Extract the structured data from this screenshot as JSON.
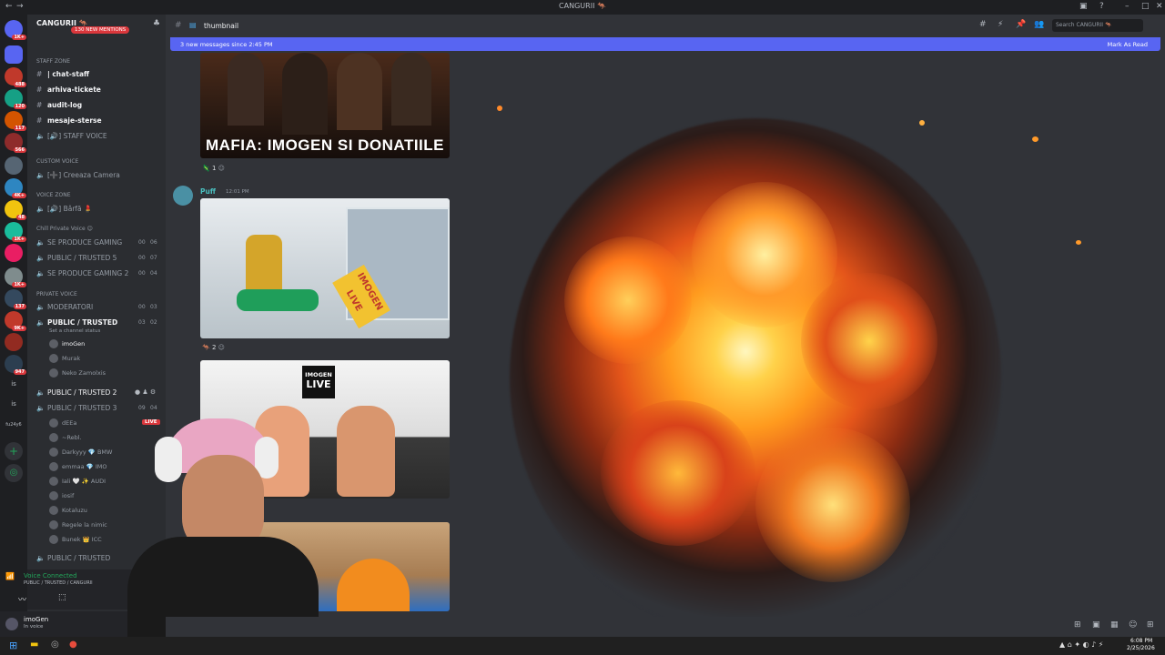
{
  "window": {
    "title": "CANGURII 🦘"
  },
  "servers": {
    "badges": [
      "1K+",
      "488",
      "120",
      "117",
      "566",
      "4K+",
      "48",
      "1K+",
      "1K+",
      "137",
      "9K+",
      "947"
    ],
    "text_items": [
      "is",
      "is",
      "fu24y6"
    ]
  },
  "sidebar": {
    "guild_name": "CANGURII 🦘",
    "new_mentions": "130 NEW MENTIONS",
    "staff_zone": "STAFF ZONE",
    "channels_staff": [
      "| chat-staff",
      "arhiva-tickete",
      "audit-log",
      "mesaje-sterse"
    ],
    "staff_voice": "[🔊] STAFF VOICE",
    "custom_voice": "CUSTOM VOICE",
    "creeaza": "[➕] Creeaza Camera",
    "voice_zone": "VOICE ZONE",
    "barfa": "[🔊] Bârfă 💄",
    "chill_private": "Chill Private Voice 😊",
    "chill_channels": [
      {
        "name": "SE PRODUCE GAMING",
        "a": "00",
        "b": "06"
      },
      {
        "name": "PUBLIC / TRUSTED 5",
        "a": "00",
        "b": "07"
      },
      {
        "name": "SE PRODUCE GAMING 2",
        "a": "00",
        "b": "04"
      }
    ],
    "private_voice": "PRIVATE VOICE",
    "private_channels": [
      {
        "name": "MODERATORI",
        "a": "00",
        "b": "03"
      },
      {
        "name": "PUBLIC / TRUSTED",
        "a": "03",
        "b": "02"
      }
    ],
    "channel_status": "Set a channel status",
    "users_trusted": [
      "imoGen",
      "Murak",
      "Neko Zamolxis"
    ],
    "trusted2": "PUBLIC / TRUSTED 2",
    "trusted3": "PUBLIC / TRUSTED 3",
    "trusted3_counts": {
      "a": "09",
      "b": "04"
    },
    "users_trusted3": [
      "dEEa",
      "~Rebl.",
      "Darkyyy 💎 BMW",
      "emmaa 💎 IMO",
      "Iali 🤍 ✨ AUDI",
      "iosif",
      "Kotaluzu",
      "Regele la nimic",
      "Bunek 👑 ICC"
    ],
    "live_label": "LIVE",
    "trusted_last": "PUBLIC / TRUSTED"
  },
  "voice": {
    "status": "Voice Connected",
    "channel": "PUBLIC / TRUSTED / CANGURII"
  },
  "user": {
    "name": "imoGen",
    "status": "In voice"
  },
  "topbar": {
    "channel": "thumbnail",
    "search_placeholder": "Search CANGURII 🦘"
  },
  "banner": {
    "text": "3 new messages since 2:45 PM",
    "mark_read": "Mark As Read"
  },
  "messages": {
    "thumb1_title": "MAFIA: IMOGEN SI DONATIILE",
    "react1": "1",
    "author": "Puff",
    "time": "12:01 PM",
    "react2": "2",
    "thumb3_label1": "IMOGEN",
    "thumb3_label2": "LIVE",
    "sign_text": "IMOGEN LIVE"
  },
  "taskbar": {
    "time": "6:08 PM",
    "date": "2/25/2026"
  }
}
